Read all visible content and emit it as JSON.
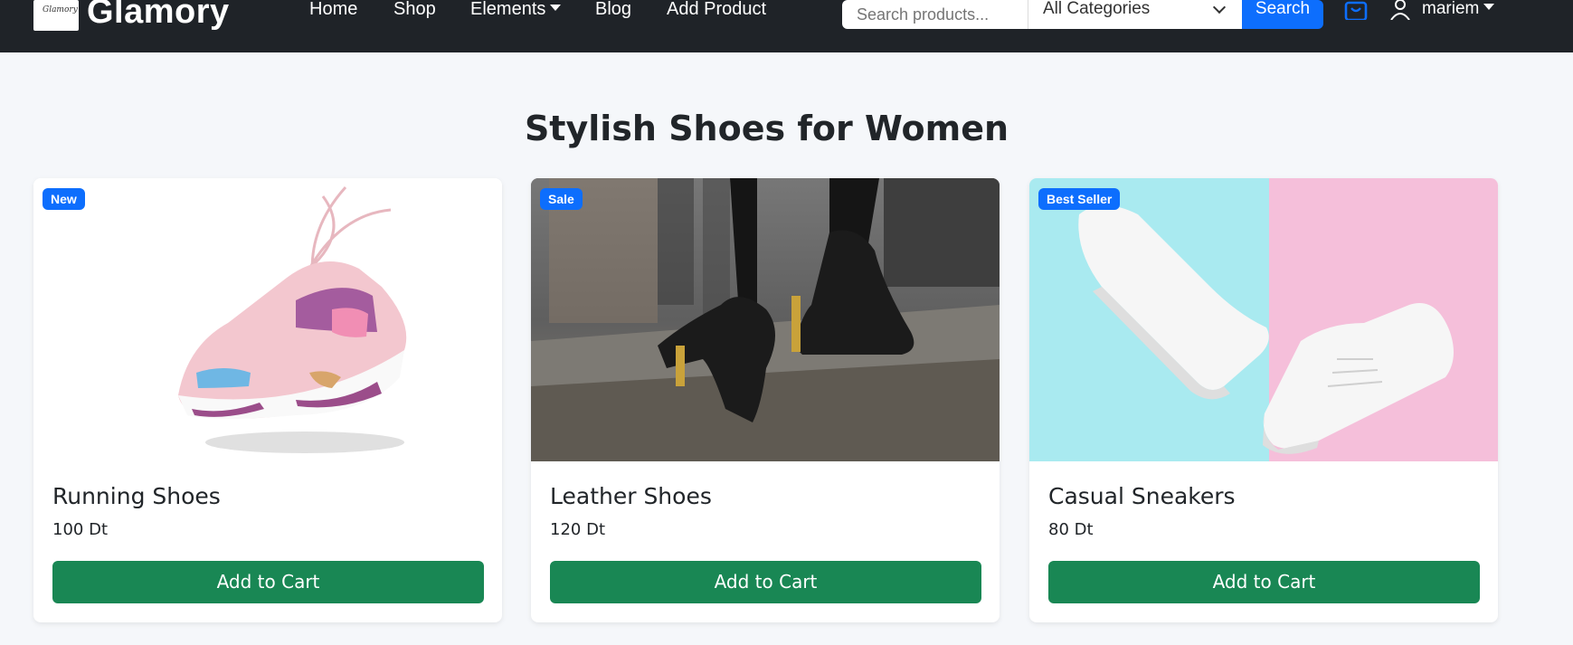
{
  "navbar": {
    "brand_name": "Glamory",
    "logo_text": "Glamory",
    "links": [
      {
        "label": "Home"
      },
      {
        "label": "Shop"
      },
      {
        "label": "Elements"
      },
      {
        "label": "Blog"
      },
      {
        "label": "Add Product"
      }
    ],
    "search_placeholder": "Search products...",
    "category_selected": "All Categories",
    "search_button": "Search",
    "user_name": "mariem"
  },
  "page": {
    "title": "Stylish Shoes for Women"
  },
  "products": [
    {
      "badge": "New",
      "name": "Running Shoes",
      "price": "100 Dt",
      "button": "Add to Cart",
      "image_icon": "pink-running-shoe"
    },
    {
      "badge": "Sale",
      "name": "Leather Shoes",
      "price": "120 Dt",
      "button": "Add to Cart",
      "image_icon": "black-leather-ankle-boots"
    },
    {
      "badge": "Best Seller",
      "name": "Casual Sneakers",
      "price": "80 Dt",
      "button": "Add to Cart",
      "image_icon": "white-sneakers"
    }
  ],
  "colors": {
    "navbar_bg": "#1f2328",
    "primary": "#0d6efd",
    "success": "#198754",
    "page_bg": "#f5f7fa"
  }
}
